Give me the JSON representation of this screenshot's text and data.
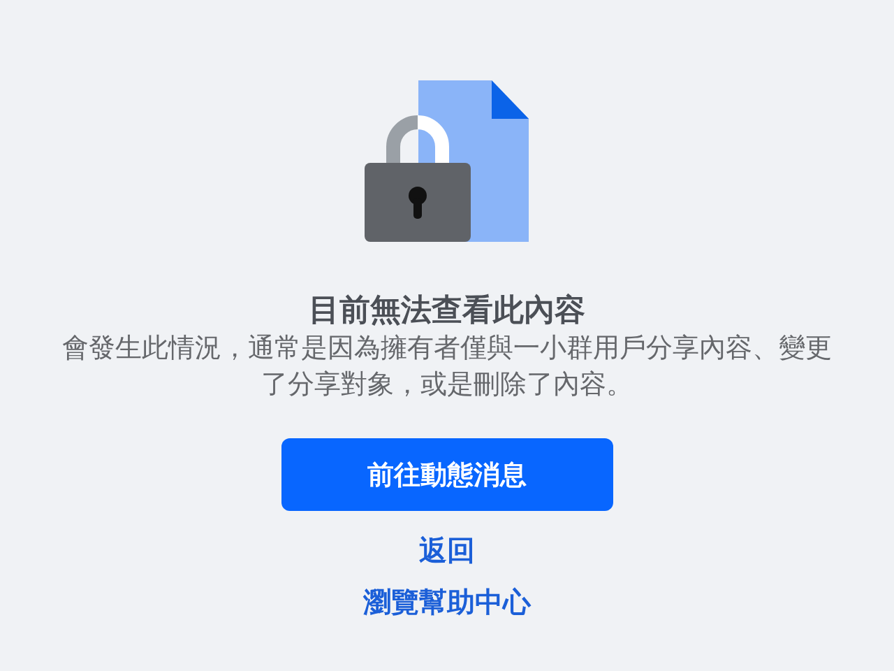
{
  "title": "目前無法查看此內容",
  "message": "會發生此情況，通常是因為擁有者僅與一小群用戶分享內容、變更了分享對象，或是刪除了內容。",
  "primary_button": {
    "label": "前往動態消息"
  },
  "links": [
    {
      "label": "返回"
    },
    {
      "label": "瀏覽幫助中心"
    }
  ]
}
